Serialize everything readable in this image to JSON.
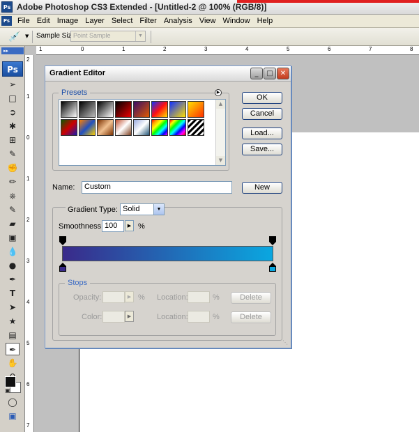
{
  "window": {
    "title": "Adobe Photoshop CS3 Extended - [Untitled-2 @ 100% (RGB/8)]",
    "app_icon": "Ps"
  },
  "menu": {
    "items": [
      "File",
      "Edit",
      "Image",
      "Layer",
      "Select",
      "Filter",
      "Analysis",
      "View",
      "Window",
      "Help"
    ]
  },
  "options": {
    "sample_size_label": "Sample Size:",
    "sample_size_value": "Point Sample"
  },
  "toolbox": {
    "logo": "Ps"
  },
  "rulers": {
    "top_labels": [
      "1",
      "0",
      "1",
      "2",
      "3",
      "4",
      "5",
      "6",
      "7",
      "8"
    ],
    "left_labels": [
      "2",
      "1",
      "0",
      "1",
      "2",
      "3",
      "4",
      "5",
      "6",
      "7"
    ]
  },
  "dialog": {
    "title": "Gradient Editor",
    "presets_label": "Presets",
    "ok_label": "OK",
    "cancel_label": "Cancel",
    "load_label": "Load...",
    "save_label": "Save...",
    "name_label": "Name:",
    "name_value": "Custom",
    "new_label": "New",
    "gradient_type_label": "Gradient Type:",
    "gradient_type_value": "Solid",
    "smoothness_label": "Smoothness:",
    "smoothness_value": "100",
    "smoothness_unit": "%",
    "stops_label": "Stops",
    "opacity_label": "Opacity:",
    "opacity_unit": "%",
    "location_label": "Location:",
    "location_unit": "%",
    "delete_label": "Delete",
    "color_label": "Color:",
    "gradient_start_color": "#3a2a8a",
    "gradient_end_color": "#0aa7e0",
    "preset_gradients": [
      "linear-gradient(135deg,#000,#fff)",
      "linear-gradient(135deg,#000,#bbb)",
      "linear-gradient(135deg,#000,#fff)",
      "linear-gradient(135deg,#000,#e00)",
      "linear-gradient(135deg,#3a0d66,#e05a00)",
      "linear-gradient(135deg,#1030ff,#ff1010,#ffe000)",
      "linear-gradient(135deg,#1030ff,#ffe000)",
      "linear-gradient(135deg,#ffe000,#ff3000)",
      "linear-gradient(135deg,#0a5a00,#c00,#1a1ab0)",
      "linear-gradient(135deg,#ff8000,#2050c0,#ffd000)",
      "linear-gradient(135deg,#7a3000,#f0c090,#7a3000)",
      "linear-gradient(135deg,#c05030,#ffffff,#804020)",
      "linear-gradient(135deg,#9ad,#fff,#257)",
      "linear-gradient(135deg,red,orange,yellow,lime,cyan,blue,magenta)",
      "linear-gradient(135deg,red,yellow,lime,cyan,blue,magenta,red)",
      "repeating-linear-gradient(135deg,#000 0 3px,#fff 3px 6px)"
    ]
  }
}
